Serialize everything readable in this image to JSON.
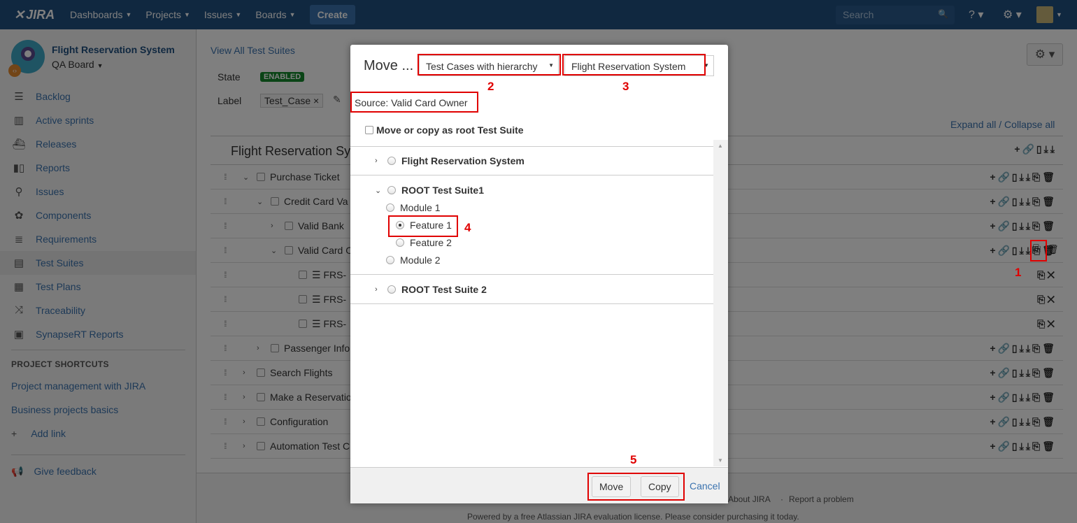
{
  "topbar": {
    "logo": "JIRA",
    "nav": [
      "Dashboards",
      "Projects",
      "Issues",
      "Boards"
    ],
    "create": "Create",
    "search_placeholder": "Search"
  },
  "sidebar": {
    "project_name": "Flight Reservation System",
    "board": "QA Board",
    "items": [
      {
        "label": "Backlog",
        "icon": "backlog-icon"
      },
      {
        "label": "Active sprints",
        "icon": "sprint-icon"
      },
      {
        "label": "Releases",
        "icon": "ship-icon"
      },
      {
        "label": "Reports",
        "icon": "chart-icon"
      },
      {
        "label": "Issues",
        "icon": "issues-icon"
      },
      {
        "label": "Components",
        "icon": "puzzle-icon"
      },
      {
        "label": "Requirements",
        "icon": "lines-icon"
      },
      {
        "label": "Test Suites",
        "icon": "suite-icon"
      },
      {
        "label": "Test Plans",
        "icon": "plan-icon"
      },
      {
        "label": "Traceability",
        "icon": "shuffle-icon"
      },
      {
        "label": "SynapseRT Reports",
        "icon": "report-icon"
      }
    ],
    "shortcuts_heading": "PROJECT SHORTCUTS",
    "shortcuts": [
      "Project management with JIRA",
      "Business projects basics"
    ],
    "add_link": "Add link",
    "feedback": "Give feedback"
  },
  "main": {
    "view_all": "View All Test Suites",
    "state_label": "State",
    "state_value": "ENABLED",
    "label_label": "Label",
    "label_value": "Test_Case ×",
    "expand_collapse": "Expand all / Collapse all",
    "tree_title": "Flight Reservation Sy",
    "rows": [
      "Purchase Ticket",
      "Credit Card Va",
      "Valid Bank",
      "Valid Card O",
      "FRS-",
      "FRS-",
      "FRS-",
      "Passenger Info",
      "Search Flights",
      "Make a Reservatio",
      "Configuration",
      "Automation Test C"
    ],
    "footer_links": [
      "About JIRA",
      "Report a problem"
    ],
    "footer_license": "Powered by a free Atlassian JIRA evaluation license. Please consider purchasing it today."
  },
  "dialog": {
    "title": "Move ...",
    "select_type": "Test Cases with hierarchy",
    "select_project": "Flight Reservation System",
    "source": "Source: Valid Card Owner",
    "root_checkbox": "Move or copy as root Test Suite",
    "tree": {
      "n1": "Flight Reservation System",
      "n2": "ROOT Test Suite1",
      "n2a": "Module 1",
      "n2a1": "Feature 1",
      "n2a2": "Feature 2",
      "n2b": "Module 2",
      "n3": "ROOT Test Suite 2"
    },
    "move": "Move",
    "copy": "Copy",
    "cancel": "Cancel"
  },
  "annotations": {
    "a1": "1",
    "a2": "2",
    "a3": "3",
    "a4": "4",
    "a5": "5"
  },
  "colors": {
    "topbar": "#205081",
    "link": "#3b73af",
    "annotation": "#e00000",
    "enabled": "#14892c"
  }
}
